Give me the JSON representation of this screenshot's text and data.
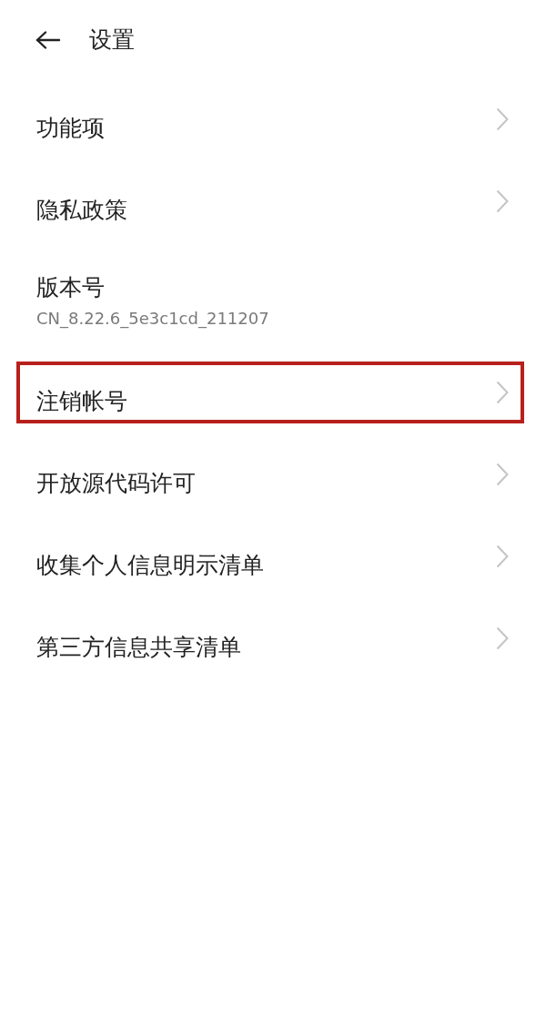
{
  "header": {
    "title": "设置"
  },
  "items": [
    {
      "label": "功能项",
      "chevron": true,
      "highlighted": false
    },
    {
      "label": "隐私政策",
      "chevron": true,
      "highlighted": false
    },
    {
      "label": "版本号",
      "subtitle": "CN_8.22.6_5e3c1cd_211207",
      "chevron": false,
      "highlighted": false
    },
    {
      "label": "注销帐号",
      "chevron": true,
      "highlighted": true
    },
    {
      "label": "开放源代码许可",
      "chevron": true,
      "highlighted": false
    },
    {
      "label": "收集个人信息明示清单",
      "chevron": true,
      "highlighted": false
    },
    {
      "label": "第三方信息共享清单",
      "chevron": true,
      "highlighted": false
    }
  ]
}
